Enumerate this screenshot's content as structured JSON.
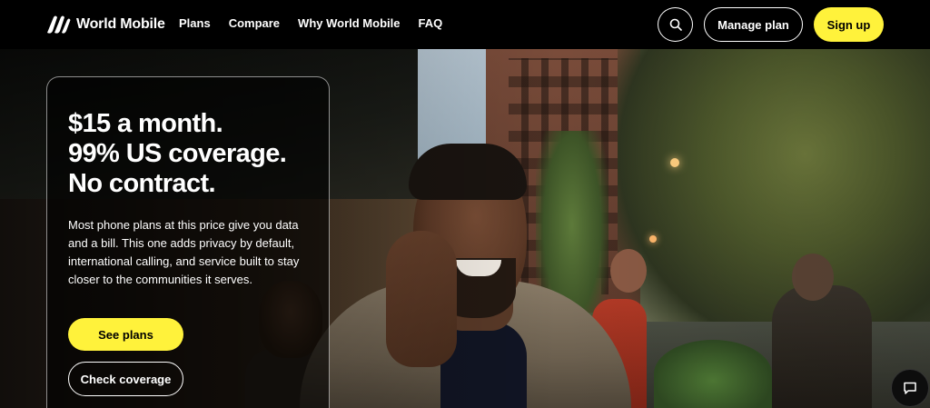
{
  "header": {
    "logo_text": "World Mobile",
    "nav": [
      {
        "label": "Plans"
      },
      {
        "label": "Compare"
      },
      {
        "label": "Why World Mobile"
      },
      {
        "label": "FAQ"
      }
    ],
    "search_icon": "search-icon",
    "manage_plan_label": "Manage plan",
    "sign_up_label": "Sign up"
  },
  "hero": {
    "headline_line1": "$15 a month.",
    "headline_line2": "99% US coverage.",
    "headline_line3": "No contract.",
    "body": "Most phone plans at this price give you data and a bill. This one adds privacy by default, international calling, and service built to stay closer to the communities it serves.",
    "primary_cta": "See plans",
    "secondary_cta": "Check coverage"
  },
  "chat": {
    "icon": "chat-icon"
  },
  "colors": {
    "accent": "#fff23b",
    "background": "#000000",
    "text": "#ffffff"
  }
}
